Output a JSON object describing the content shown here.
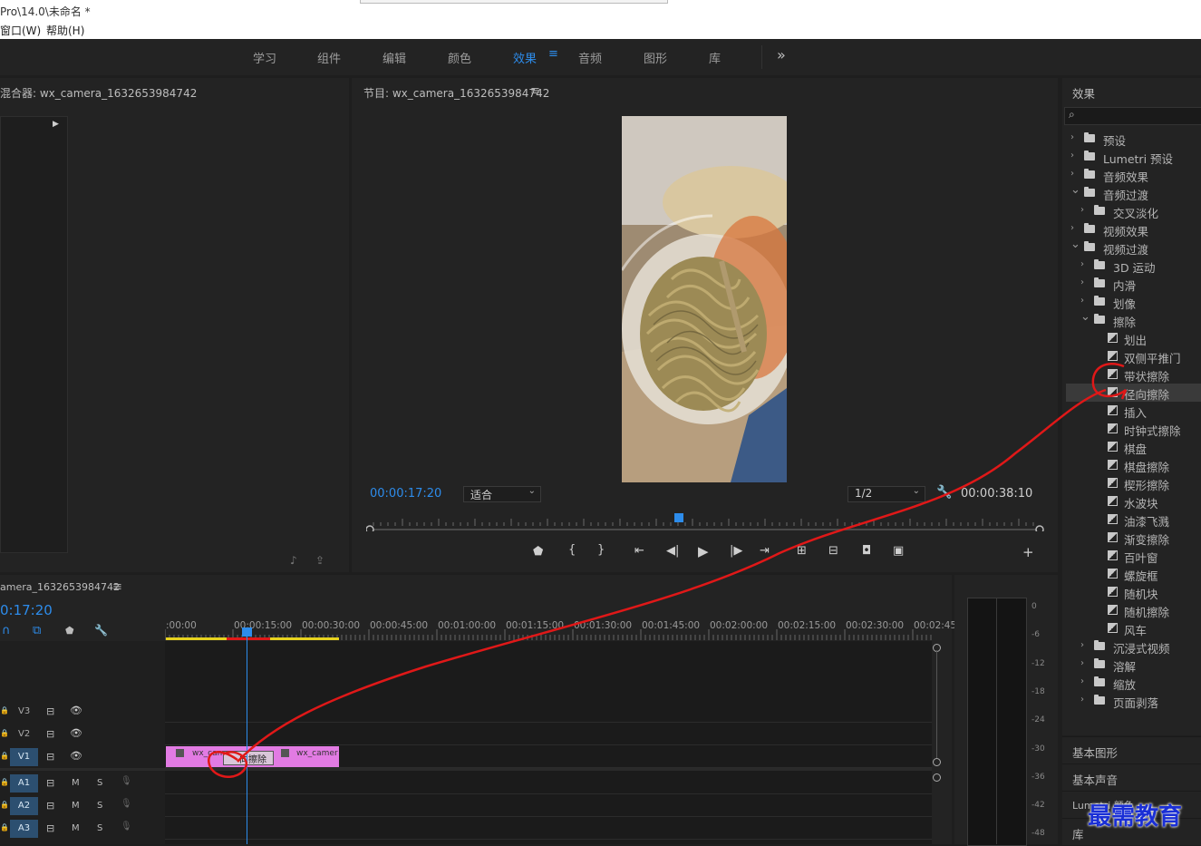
{
  "window": {
    "title": "Pro\\14.0\\未命名 *"
  },
  "menu": {
    "window": "窗口(W)",
    "help": "帮助(H)"
  },
  "workspaces": {
    "items": [
      "学习",
      "组件",
      "编辑",
      "颜色",
      "效果",
      "音频",
      "图形",
      "库"
    ],
    "active_index": 4,
    "more": "»"
  },
  "audio_mixer": {
    "title": "混合器: wx_camera_1632653984742"
  },
  "program": {
    "title": "节目: wx_camera_1632653984742",
    "timecode": "00:00:17:20",
    "zoom": "适合",
    "resolution": "1/2",
    "duration": "00:00:38:10",
    "playhead_fraction": 0.46
  },
  "effects": {
    "title": "效果",
    "search_placeholder": "",
    "tree": [
      {
        "label": "预设",
        "level": 0,
        "type": "star-folder",
        "open": false
      },
      {
        "label": "Lumetri 预设",
        "level": 0,
        "type": "star-folder",
        "open": false
      },
      {
        "label": "音频效果",
        "level": 0,
        "type": "folder",
        "open": false
      },
      {
        "label": "音频过渡",
        "level": 0,
        "type": "folder",
        "open": true
      },
      {
        "label": "交叉淡化",
        "level": 1,
        "type": "folder",
        "open": false
      },
      {
        "label": "视频效果",
        "level": 0,
        "type": "folder",
        "open": false
      },
      {
        "label": "视频过渡",
        "level": 0,
        "type": "folder",
        "open": true
      },
      {
        "label": "3D 运动",
        "level": 1,
        "type": "folder",
        "open": false
      },
      {
        "label": "内滑",
        "level": 1,
        "type": "folder",
        "open": false
      },
      {
        "label": "划像",
        "level": 1,
        "type": "folder",
        "open": false
      },
      {
        "label": "擦除",
        "level": 1,
        "type": "folder",
        "open": true
      },
      {
        "label": "划出",
        "level": 2,
        "type": "item"
      },
      {
        "label": "双侧平推门",
        "level": 2,
        "type": "item"
      },
      {
        "label": "带状擦除",
        "level": 2,
        "type": "item"
      },
      {
        "label": "径向擦除",
        "level": 2,
        "type": "item",
        "selected": true
      },
      {
        "label": "插入",
        "level": 2,
        "type": "item"
      },
      {
        "label": "时钟式擦除",
        "level": 2,
        "type": "item"
      },
      {
        "label": "棋盘",
        "level": 2,
        "type": "item"
      },
      {
        "label": "棋盘擦除",
        "level": 2,
        "type": "item"
      },
      {
        "label": "楔形擦除",
        "level": 2,
        "type": "item"
      },
      {
        "label": "水波块",
        "level": 2,
        "type": "item"
      },
      {
        "label": "油漆飞溅",
        "level": 2,
        "type": "item"
      },
      {
        "label": "渐变擦除",
        "level": 2,
        "type": "item"
      },
      {
        "label": "百叶窗",
        "level": 2,
        "type": "item"
      },
      {
        "label": "螺旋框",
        "level": 2,
        "type": "item"
      },
      {
        "label": "随机块",
        "level": 2,
        "type": "item"
      },
      {
        "label": "随机擦除",
        "level": 2,
        "type": "item"
      },
      {
        "label": "风车",
        "level": 2,
        "type": "item"
      },
      {
        "label": "沉浸式视频",
        "level": 1,
        "type": "folder",
        "open": false
      },
      {
        "label": "溶解",
        "level": 1,
        "type": "folder",
        "open": false
      },
      {
        "label": "缩放",
        "level": 1,
        "type": "folder",
        "open": false
      },
      {
        "label": "页面剥落",
        "level": 1,
        "type": "folder",
        "open": false
      }
    ],
    "bottom_panels": [
      "基本图形",
      "基本声音",
      "Lumetri 颜色",
      "库"
    ]
  },
  "timeline": {
    "title": "amera_1632653984742",
    "timecode": "0:17:20",
    "ruler": [
      ":00:00",
      "00:00:15:00",
      "00:00:30:00",
      "00:00:45:00",
      "00:01:00:00",
      "00:01:15:00",
      "00:01:30:00",
      "00:01:45:00",
      "00:02:00:00",
      "00:02:15:00",
      "00:02:30:00",
      "00:02:45:"
    ],
    "video_tracks": [
      "V3",
      "V2",
      "V1"
    ],
    "audio_tracks": [
      "A1",
      "A2",
      "A3"
    ],
    "mute": "M",
    "solo": "S",
    "clip_a": "wx_cam",
    "clip_b": "wx_camer",
    "transition_label": "向擦除"
  },
  "meter": {
    "scale": [
      "0",
      "-6",
      "-12",
      "-18",
      "-24",
      "-30",
      "-36",
      "-42",
      "-48"
    ]
  },
  "watermark": "最需教育",
  "colors": {
    "accent": "#2d8ceb",
    "clip": "#e27be3",
    "annotation": "#e01818",
    "watermark": "#1a2fd6"
  }
}
